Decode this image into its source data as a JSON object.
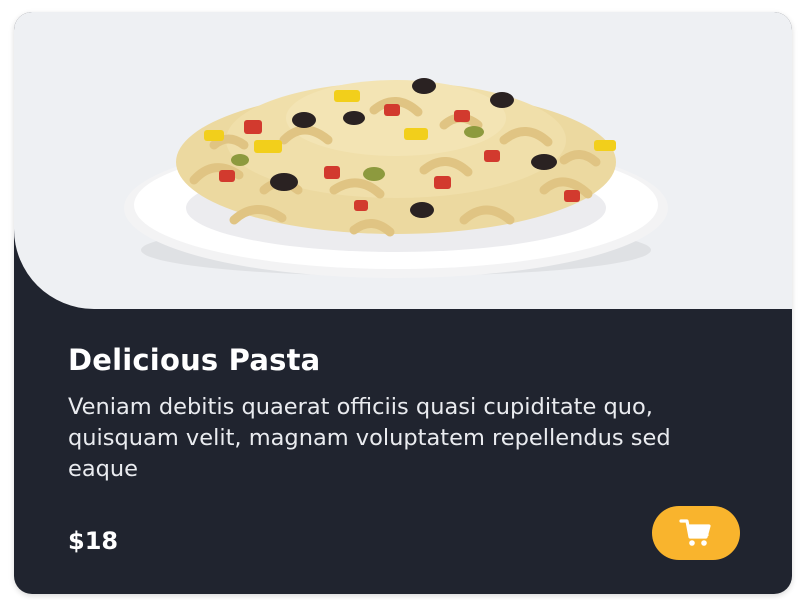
{
  "product": {
    "title": "Delicious Pasta",
    "description": "Veniam debitis quaerat officiis quasi cupiditate quo, quisquam velit, magnam voluptatem repellendus sed eaque",
    "price": "$18"
  },
  "image": {
    "subject": "pasta-salad-plate"
  },
  "actions": {
    "cart_icon": "shopping-cart-icon"
  },
  "colors": {
    "card_background": "#20242f",
    "image_background": "#eef0f3",
    "accent": "#f9b42d",
    "text": "#ffffff"
  }
}
